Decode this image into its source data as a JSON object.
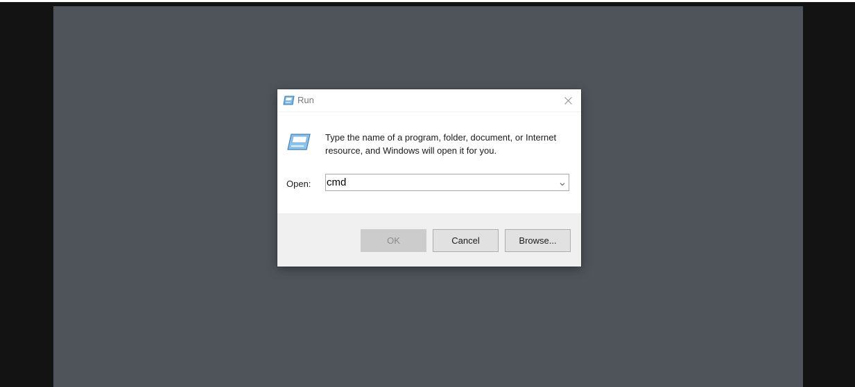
{
  "dialog": {
    "title": "Run",
    "title_icon": "run-icon",
    "close_icon": "close-icon",
    "description": "Type the name of a program, folder, document, or Internet resource, and Windows will open it for you.",
    "open_label": "Open:",
    "open_value": "cmd",
    "dropdown_icon": "chevron-down-icon",
    "buttons": {
      "ok": "OK",
      "cancel": "Cancel",
      "browse": "Browse..."
    }
  },
  "colors": {
    "desktop": "#4e545a",
    "outer_background": "#131313",
    "dialog_footer": "#f0f0f0",
    "button_face": "#e1e1e1",
    "button_disabled": "#cccccc"
  }
}
